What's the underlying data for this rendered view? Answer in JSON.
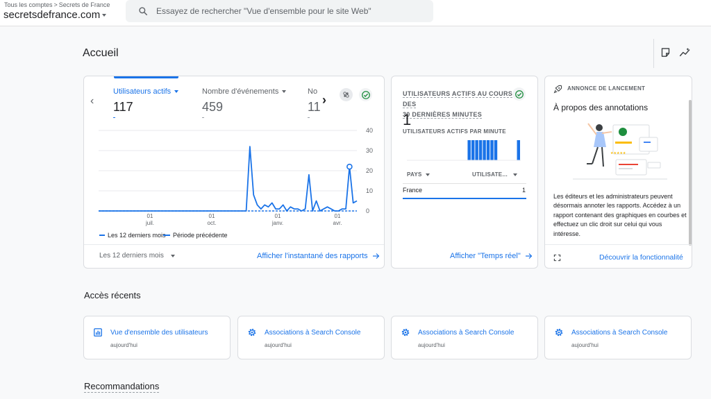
{
  "breadcrumb": {
    "root": "Tous les comptes",
    "separator": ">",
    "account": "Secrets de France"
  },
  "property": {
    "name": "secretsdefrance.com"
  },
  "search": {
    "placeholder": "Essayez de rechercher \"Vue d'ensemble pour le site Web\""
  },
  "page": {
    "title": "Accueil"
  },
  "overview": {
    "metrics": [
      {
        "label": "Utilisateurs actifs",
        "value": "117"
      },
      {
        "label": "Nombre d'événements",
        "value": "459"
      },
      {
        "label": "No",
        "value": "11"
      }
    ],
    "legend_current": "Les 12 derniers mois",
    "legend_previous": "Période précédente",
    "date_range": "Les 12 derniers mois",
    "link": "Afficher l'instantané des rapports"
  },
  "chart_data": {
    "type": "line",
    "x_ticks": [
      {
        "day": "01",
        "month": "juil."
      },
      {
        "day": "01",
        "month": "oct."
      },
      {
        "day": "01",
        "month": "janv."
      },
      {
        "day": "01",
        "month": "avr."
      }
    ],
    "y_ticks": [
      "40",
      "30",
      "20",
      "10",
      "0"
    ],
    "ylim": [
      0,
      40
    ],
    "series": [
      {
        "name": "Les 12 derniers mois",
        "color": "#1a73e8",
        "values": [
          0,
          0,
          0,
          0,
          0,
          0,
          0,
          0,
          0,
          0,
          0,
          0,
          0,
          0,
          0,
          0,
          0,
          0,
          0,
          0,
          0,
          0,
          0,
          0,
          0,
          0,
          0,
          0,
          0,
          0,
          0,
          0,
          0,
          0,
          0,
          0,
          0,
          0,
          0,
          0,
          0,
          32,
          8,
          3,
          1,
          3,
          2,
          4,
          1,
          1,
          3,
          0,
          2,
          1,
          1,
          0,
          1,
          18,
          0,
          5,
          0,
          1,
          2,
          1,
          0,
          0,
          1,
          1,
          22,
          4,
          5
        ]
      },
      {
        "name": "Période précédente",
        "color": "#1a73e8",
        "dashed": true,
        "values": [
          0,
          0,
          0,
          0,
          0,
          0,
          0,
          0,
          0,
          0,
          0,
          0,
          0,
          0,
          0,
          0,
          0,
          0,
          0,
          0,
          0,
          0,
          0,
          0,
          0,
          0,
          0,
          0,
          0,
          0,
          0,
          0,
          0,
          0,
          0,
          0,
          0,
          0,
          0,
          0,
          0,
          0,
          0,
          0,
          0,
          0,
          0,
          0,
          0,
          0,
          0,
          0,
          0,
          0,
          0,
          0,
          0,
          0,
          0,
          0,
          0,
          0,
          0,
          0,
          0,
          0,
          0,
          0,
          0,
          0,
          0
        ]
      }
    ]
  },
  "realtime": {
    "title_line1": "UTILISATEURS ACTIFS AU COURS DES",
    "title_line2": "30 DERNIÈRES MINUTES",
    "value": "1",
    "per_minute_label": "UTILISATEURS ACTIFS PAR MINUTE",
    "per_minute_bars": [
      0,
      0,
      0,
      0,
      0,
      0,
      0,
      0,
      0,
      0,
      0,
      0,
      0,
      0,
      0,
      0,
      1,
      1,
      1,
      1,
      1,
      1,
      1,
      1,
      0,
      0,
      0,
      0,
      0,
      1
    ],
    "col_country": "PAYS",
    "col_users": "UTILISATE...",
    "rows": [
      {
        "country": "France",
        "users": "1"
      }
    ],
    "link": "Afficher \"Temps réel\""
  },
  "launch": {
    "tag": "ANNONCE DE LANCEMENT",
    "title": "À propos des annotations",
    "body": "Les éditeurs et les administrateurs peuvent désormais annoter les rapports. Accédez à un rapport contenant des graphiques en courbes et effectuez un clic droit sur celui qui vous intéresse.",
    "link": "Découvrir la fonctionnalité"
  },
  "recent": {
    "title": "Accès récents",
    "items": [
      {
        "title": "Vue d'ensemble des utilisateurs",
        "date": "aujourd'hui",
        "icon": "report-icon"
      },
      {
        "title": "Associations à Search Console",
        "date": "aujourd'hui",
        "icon": "gear-icon"
      },
      {
        "title": "Associations à Search Console",
        "date": "aujourd'hui",
        "icon": "gear-icon"
      },
      {
        "title": "Associations à Search Console",
        "date": "aujourd'hui",
        "icon": "gear-icon"
      }
    ]
  },
  "recommendations": {
    "title": "Recommandations"
  },
  "colors": {
    "accent": "#1a73e8",
    "success": "#1e8e3e"
  }
}
